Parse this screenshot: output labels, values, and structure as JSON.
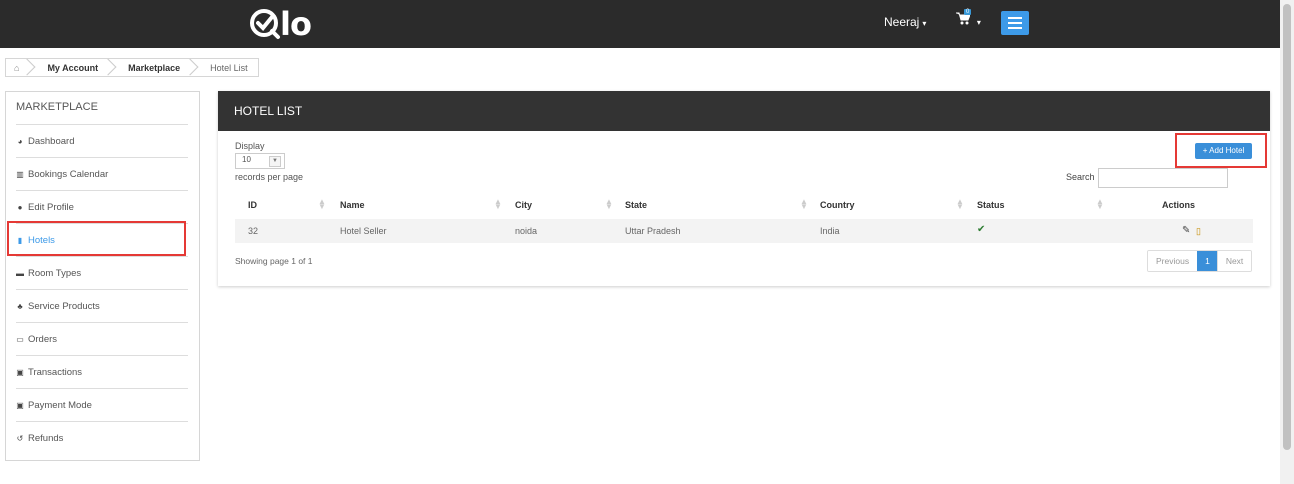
{
  "header": {
    "logo_text": "lo",
    "user_name": "Neeraj",
    "cart_count": "0"
  },
  "breadcrumb": {
    "items": [
      "My Account",
      "Marketplace",
      "Hotel List"
    ]
  },
  "sidebar": {
    "title": "MARKETPLACE",
    "items": [
      {
        "label": "Dashboard",
        "icon": "tachometer-icon"
      },
      {
        "label": "Bookings Calendar",
        "icon": "bar-chart-icon"
      },
      {
        "label": "Edit Profile",
        "icon": "user-icon"
      },
      {
        "label": "Hotels",
        "icon": "building-icon"
      },
      {
        "label": "Room Types",
        "icon": "bed-icon"
      },
      {
        "label": "Service Products",
        "icon": "user-plus-icon"
      },
      {
        "label": "Orders",
        "icon": "credit-card-icon"
      },
      {
        "label": "Transactions",
        "icon": "money-icon"
      },
      {
        "label": "Payment Mode",
        "icon": "money-icon"
      },
      {
        "label": "Refunds",
        "icon": "undo-icon"
      }
    ],
    "active_item": "Hotels"
  },
  "panel": {
    "title": "HOTEL LIST",
    "display_label": "Display",
    "per_page_value": "10",
    "records_label": "records per page",
    "add_button_label": "+ Add Hotel",
    "search_label": "Search",
    "search_value": "",
    "columns": [
      "ID",
      "Name",
      "City",
      "State",
      "Country",
      "Status",
      "Actions"
    ],
    "rows": [
      {
        "id": "32",
        "name": "Hotel Seller",
        "city": "noida",
        "state": "Uttar Pradesh",
        "country": "India",
        "status": "active"
      }
    ],
    "showing_text": "Showing page 1 of 1",
    "pagination": {
      "previous": "Previous",
      "current": "1",
      "next": "Next"
    }
  },
  "colors": {
    "header_bg": "#2b2b2b",
    "accent": "#3a8fd9",
    "highlight": "#e53935",
    "panel_head_bg": "#333333"
  }
}
